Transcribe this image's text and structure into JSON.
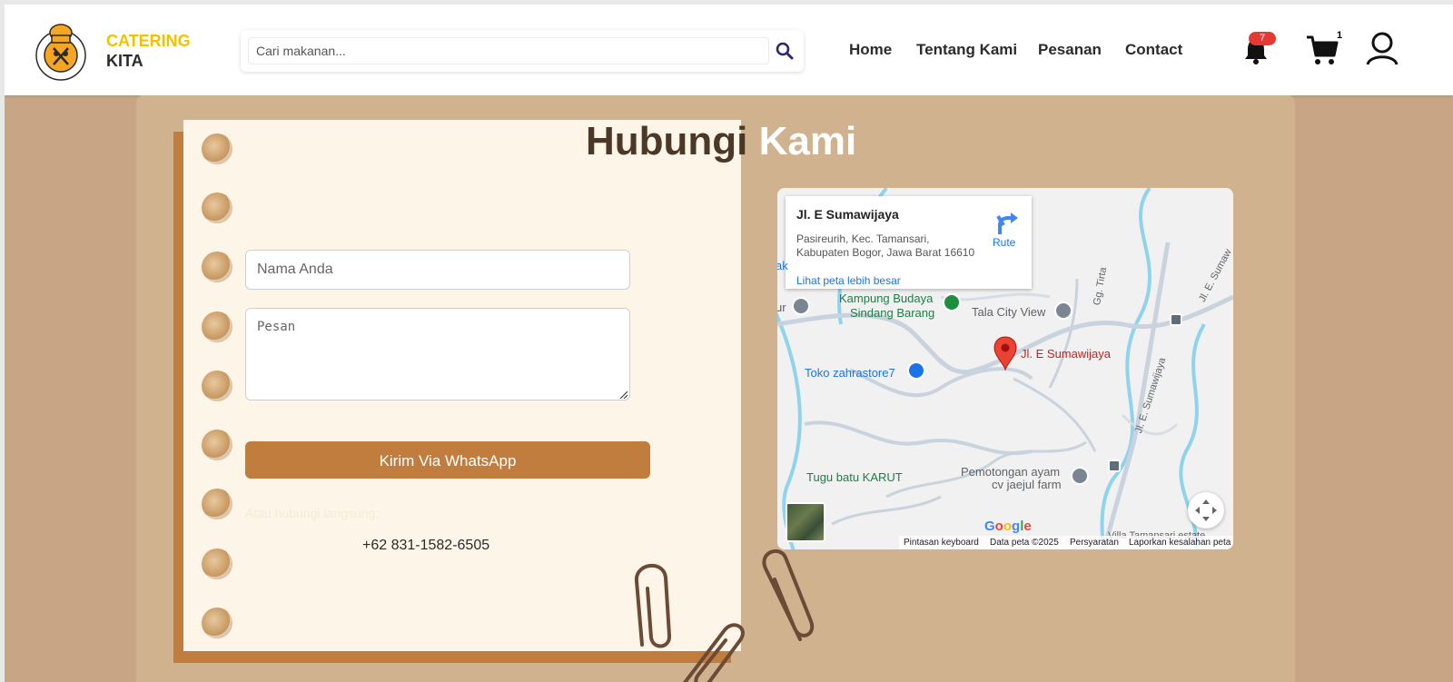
{
  "header": {
    "brand_line1": "CATERING",
    "brand_line2": "KITA",
    "logo_text": "CATERING KITA",
    "search_placeholder": "Cari makanan...",
    "nav": [
      {
        "label": "Home"
      },
      {
        "label": "Tentang Kami"
      },
      {
        "label": "Pesanan"
      },
      {
        "label": "Contact"
      }
    ],
    "notification_count": "7",
    "cart_count": "1",
    "colors": {
      "brand_yellow": "#f2c200",
      "badge_red": "#e53935"
    }
  },
  "contact": {
    "title_part1": "Hubungi",
    "title_part2": "Kami",
    "name_placeholder": "Nama Anda",
    "message_placeholder": "Pesan",
    "whatsapp_button": "Kirim Via WhatsApp",
    "direct_label": "Atau hubungi langsung:",
    "phone": "+62 831-1582-6505",
    "colors": {
      "accent": "#c07d3e",
      "background": "#d1b28f",
      "paper": "#fdf6e8"
    }
  },
  "map": {
    "place_name": "Jl. E Sumawijaya",
    "address_line1": "Pasireurih, Kec. Tamansari,",
    "address_line2": "Kabupaten Bogor, Jawa Barat 16610",
    "route_label": "Rute",
    "larger_map_link": "Lihat peta lebih besar",
    "labels": {
      "kampung_line1": "Kampung Budaya",
      "kampung_line2": "Sindang Barang",
      "tala": "Tala City View",
      "pin_label": "Jl. E Sumawijaya",
      "toko": "Toko zahrastore7",
      "tugu": "Tugu batu KARUT",
      "pemotongan_line1": "Pemotongan ayam",
      "pemotongan_line2": "cv jaejul farm",
      "road_tirta": "Gg. Tirta",
      "road_sumawijaya": "Jl. E. Sumawijaya",
      "road_sumaw": "Jl. E. Sumaw",
      "villa": "Villa Tamansari estate",
      "edge_left1": "ak",
      "edge_left2": "ur"
    },
    "google_logo": "Google",
    "footer": {
      "keyboard": "Pintasan keyboard",
      "data": "Data peta ©2025",
      "terms": "Persyaratan",
      "report": "Laporkan kesalahan peta"
    }
  }
}
